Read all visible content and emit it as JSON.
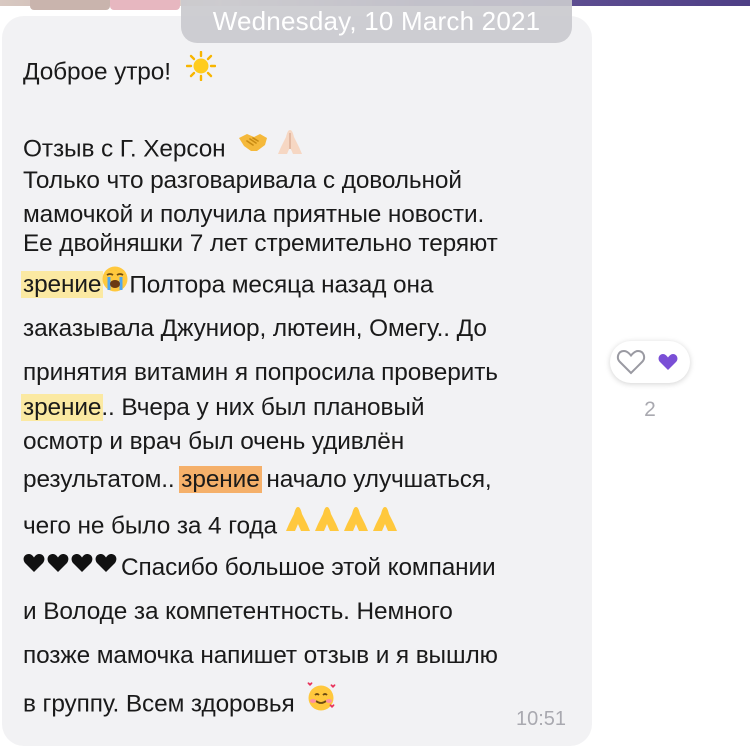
{
  "header": {
    "date": "Wednesday, 10 March 2021"
  },
  "message": {
    "greeting": "Доброе утро!",
    "l2": "Отзыв с Г. Херсон",
    "l3": "Только что разговаривала с довольной",
    "l4": "мамочкой и получила приятные новости.",
    "l5": "Ее двойняшки 7 лет стремительно теряют",
    "l6a": "зрение",
    "l6b": "Полтора месяца назад она",
    "l7": "заказывала Джуниор, лютеин, Омегу.. До",
    "l8": "принятия витамин я попросила проверить",
    "l9a": "зрение",
    "l9b": ".. Вчера у них был плановый",
    "l10": "осмотр и врач был очень удивлён",
    "l11a": "результатом.. ",
    "l11b": "зрение",
    "l11c": " начало улучшаться,",
    "l12": "чего не было за 4 года",
    "l13": "Спасибо большое этой компании",
    "l14": "и Володе за компетентность. Немного",
    "l15": "позже мамочка напишет отзыв и я вышлю",
    "l16": "в группу.  Всем здоровья",
    "time": "10:51"
  },
  "reactions": {
    "count": "2"
  },
  "colors": {
    "highlight": "#fbe9a2",
    "highlight_current": "#f5b06a",
    "bubble": "#f2f2f4",
    "reaction_heart": "#7a4fd6"
  },
  "icons": [
    "sun-emoji",
    "handshake-emoji",
    "pray-emoji",
    "crying-emoji",
    "black-heart-emoji",
    "smiling-hearts-emoji",
    "empty-heart-icon",
    "purple-heart-icon"
  ]
}
